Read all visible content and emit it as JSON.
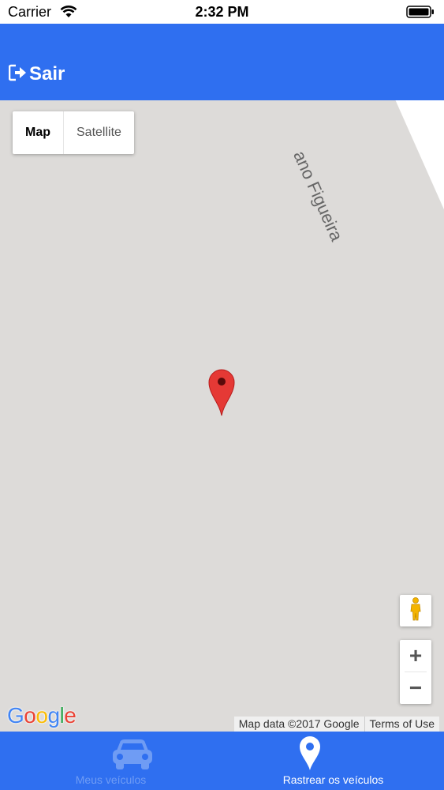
{
  "status_bar": {
    "carrier": "Carrier",
    "time": "2:32 PM"
  },
  "header": {
    "logout_label": "Sair",
    "background": "#2f6ff0"
  },
  "map": {
    "map_type": {
      "map_label": "Map",
      "satellite_label": "Satellite",
      "selected": "Map"
    },
    "road_label": "ano Figueira",
    "zoom_in": "+",
    "zoom_out": "−",
    "google_logo": "Google",
    "attribution": {
      "map_data": "Map data ©2017 Google",
      "terms": "Terms of Use"
    },
    "marker_color": "#e53935"
  },
  "tabs": [
    {
      "label": "Meus veículos",
      "icon": "car-icon",
      "active": false
    },
    {
      "label": "Rastrear os veículos",
      "icon": "location-pin-icon",
      "active": true
    }
  ]
}
